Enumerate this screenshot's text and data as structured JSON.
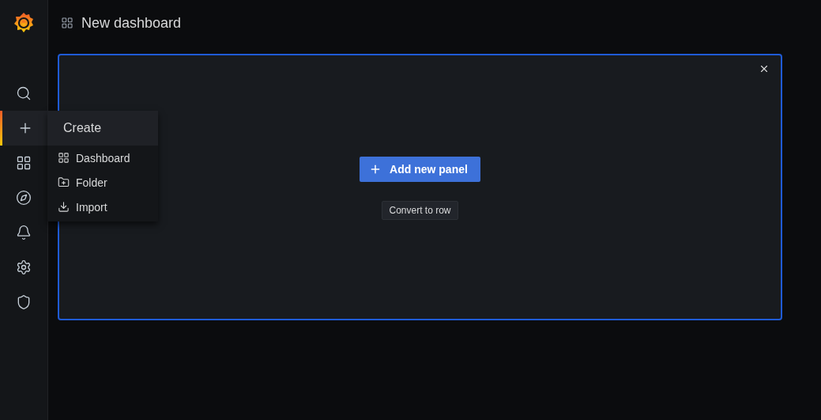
{
  "header": {
    "title": "New dashboard"
  },
  "sidebar": {
    "items": [
      {
        "kind": "search",
        "selected": false
      },
      {
        "kind": "create",
        "selected": true
      },
      {
        "kind": "dashboards",
        "selected": false
      },
      {
        "kind": "explore",
        "selected": false
      },
      {
        "kind": "alerting",
        "selected": false
      },
      {
        "kind": "configuration",
        "selected": false
      },
      {
        "kind": "admin",
        "selected": false
      }
    ]
  },
  "create_menu": {
    "title": "Create",
    "items": [
      {
        "kind": "dashboard",
        "label": "Dashboard"
      },
      {
        "kind": "folder",
        "label": "Folder"
      },
      {
        "kind": "import",
        "label": "Import"
      }
    ]
  },
  "panel": {
    "primary_button": "Add new panel",
    "secondary_button": "Convert to row"
  }
}
